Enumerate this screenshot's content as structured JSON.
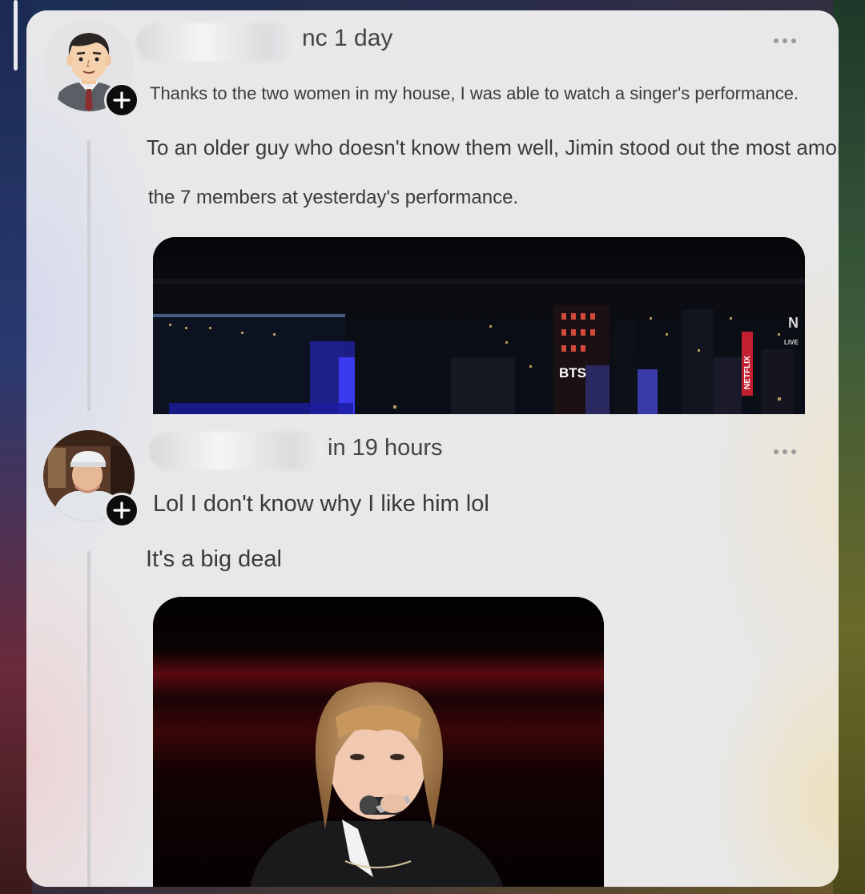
{
  "posts": [
    {
      "time": "nc 1 day",
      "lines": [
        "Thanks to the two women in my house, I was able to watch a singer's performance.",
        "To an older guy who doesn't know them well, Jimin stood out the most among",
        "the 7 members at yesterday's performance."
      ],
      "image_text": {
        "sign1": "BTS",
        "sign2": "NETFLIX",
        "corner_logo": "N",
        "corner_sub": "LIVE"
      }
    },
    {
      "time": "in 19 hours",
      "lines": [
        "Lol I don't know why I like him lol",
        "It's a big deal"
      ]
    }
  ],
  "colors": {
    "card": "#e8e8ea",
    "text": "#3a3a3c",
    "follow_badge": "#0d0d0d"
  },
  "icons": {
    "follow": "plus-icon",
    "menu": "more-horizontal-icon"
  }
}
